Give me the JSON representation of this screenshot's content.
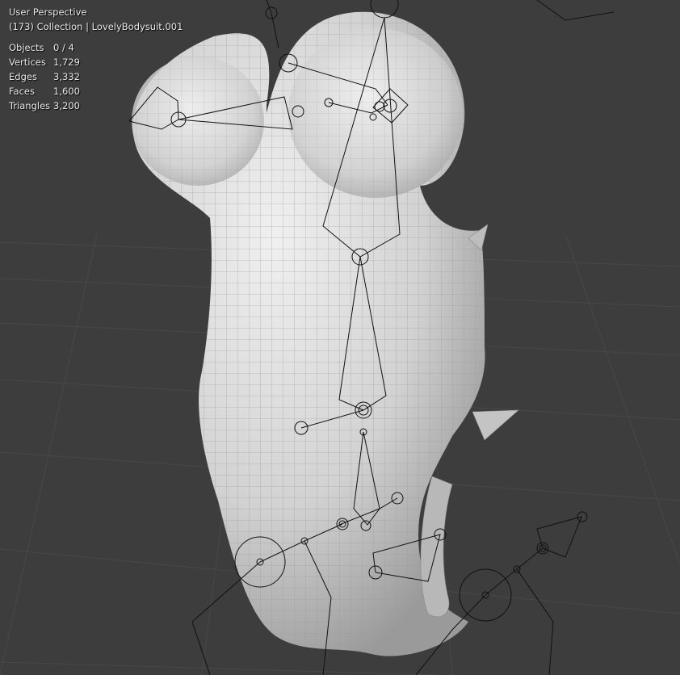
{
  "viewport": {
    "view_name": "User Perspective",
    "collection_line": "(173) Collection | LovelyBodysuit.001",
    "background_color": "#3d3d3d",
    "mesh_color": "#d9d9d9",
    "wire_color": "#8c8c8c"
  },
  "stats": [
    {
      "label": "Objects",
      "value": "0 / 4"
    },
    {
      "label": "Vertices",
      "value": "1,729"
    },
    {
      "label": "Edges",
      "value": "3,332"
    },
    {
      "label": "Faces",
      "value": "1,600"
    },
    {
      "label": "Triangles",
      "value": "3,200"
    }
  ]
}
